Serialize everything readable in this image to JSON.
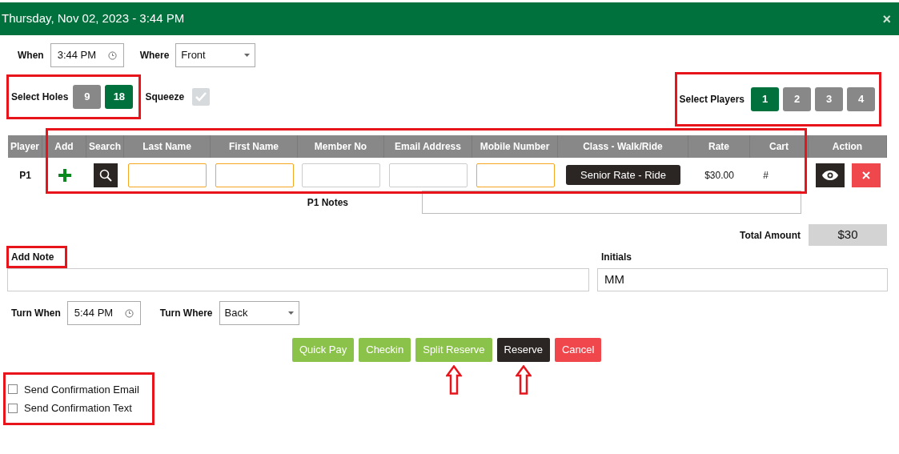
{
  "window": {
    "title": "Thursday, Nov 02, 2023 - 3:44 PM",
    "close": "×"
  },
  "when": {
    "label": "When",
    "value": "3:44 PM"
  },
  "where": {
    "label": "Where",
    "value": "Front"
  },
  "holes": {
    "label": "Select Holes",
    "highlighted": true,
    "options": [
      {
        "label": "9",
        "selected": false
      },
      {
        "label": "18",
        "selected": true
      }
    ]
  },
  "squeeze": {
    "label": "Squeeze",
    "checked": true
  },
  "players": {
    "label": "Select Players",
    "highlighted": true,
    "options": [
      {
        "label": "1",
        "selected": true
      },
      {
        "label": "2",
        "selected": false
      },
      {
        "label": "3",
        "selected": false
      },
      {
        "label": "4",
        "selected": false
      }
    ]
  },
  "table": {
    "highlighted": true,
    "columns": [
      "Player",
      "Add",
      "Search",
      "Last Name",
      "First Name",
      "Member No",
      "Email Address",
      "Mobile Number",
      "Class - Walk/Ride",
      "Rate",
      "Cart",
      "Action"
    ],
    "rows": [
      {
        "player": "P1",
        "fields": [
          {
            "kind": "text",
            "required": true
          },
          {
            "kind": "text",
            "required": true
          },
          {
            "kind": "text",
            "required": false
          },
          {
            "kind": "text",
            "required": false
          },
          {
            "kind": "text",
            "required": true
          }
        ],
        "class": "Senior Rate - Ride",
        "rate": "$30.00",
        "cart": "#",
        "notes_label": "P1 Notes"
      }
    ]
  },
  "total": {
    "label": "Total Amount",
    "value": "$30"
  },
  "add_note": {
    "label": "Add Note",
    "highlighted": true
  },
  "initials": {
    "label": "Initials",
    "value": "MM"
  },
  "turn_when": {
    "label": "Turn When",
    "value": "5:44 PM"
  },
  "turn_where": {
    "label": "Turn Where",
    "value": "Back"
  },
  "buttons": [
    {
      "label": "Quick Pay",
      "kind": "success",
      "arrow": false
    },
    {
      "label": "Checkin",
      "kind": "success",
      "arrow": false
    },
    {
      "label": "Split Reserve",
      "kind": "success",
      "arrow": true
    },
    {
      "label": "Reserve",
      "kind": "dark",
      "arrow": true
    },
    {
      "label": "Cancel",
      "kind": "danger",
      "arrow": false
    }
  ],
  "confirmations": {
    "highlighted": true,
    "items": [
      {
        "label": "Send Confirmation Email",
        "checked": false
      },
      {
        "label": "Send Confirmation Text",
        "checked": false
      }
    ]
  }
}
